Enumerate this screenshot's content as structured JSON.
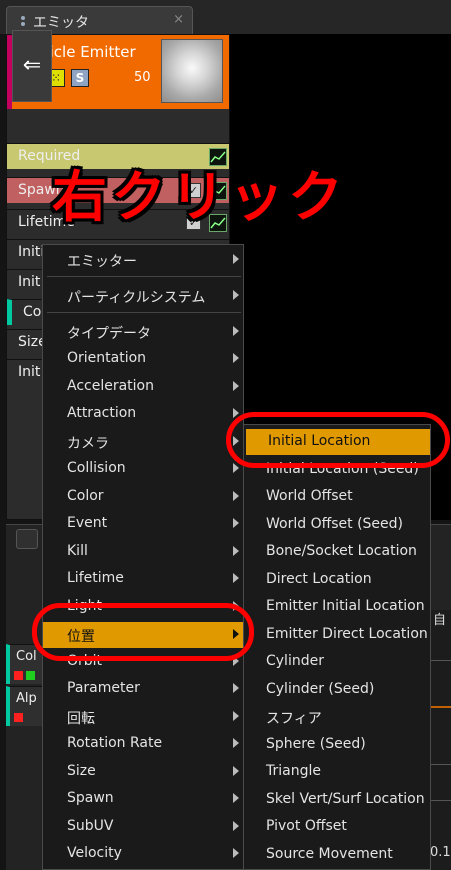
{
  "tab": {
    "title": "エミッタ",
    "close": "×"
  },
  "emitter": {
    "name": "Particle Emitter",
    "count": "50",
    "solo_label": "S",
    "colors": {
      "header": "#f06a00",
      "accent": "#c2005e"
    }
  },
  "modules": [
    {
      "label": "Required",
      "color": "#c8c870"
    },
    {
      "label": "Spawn",
      "color": "#c06060"
    },
    {
      "label": "Lifetime",
      "color": "#2c2c2c"
    },
    {
      "label": "Initial Size",
      "color": "#2c2c2c"
    },
    {
      "label": "Init",
      "color": "#2c2c2c"
    },
    {
      "label": "Col",
      "color": "#2c2c2c"
    },
    {
      "label": "Size",
      "color": "#2c2c2c"
    },
    {
      "label": "Init",
      "color": "#2c2c2c"
    }
  ],
  "annotation": {
    "text": "右クリック",
    "color": "#ff0000"
  },
  "lower": {
    "rows": [
      {
        "label": "Col"
      },
      {
        "label": "Alp"
      }
    ],
    "side_text": "自",
    "side_num": "0.1"
  },
  "context_menu": {
    "items": [
      {
        "label": "エミッター",
        "submenu": true
      },
      {
        "label": "パーティクルシステム",
        "submenu": true
      },
      {
        "label": "タイプデータ",
        "submenu": true
      },
      {
        "label": "Orientation",
        "submenu": true
      },
      {
        "label": "Acceleration",
        "submenu": true
      },
      {
        "label": "Attraction",
        "submenu": true
      },
      {
        "label": "カメラ",
        "submenu": true
      },
      {
        "label": "Collision",
        "submenu": true
      },
      {
        "label": "Color",
        "submenu": true
      },
      {
        "label": "Event",
        "submenu": true
      },
      {
        "label": "Kill",
        "submenu": true
      },
      {
        "label": "Lifetime",
        "submenu": true
      },
      {
        "label": "Light",
        "submenu": true
      },
      {
        "label": "位置",
        "submenu": true,
        "selected": true
      },
      {
        "label": "Orbit",
        "submenu": true
      },
      {
        "label": "Parameter",
        "submenu": true
      },
      {
        "label": "回転",
        "submenu": true
      },
      {
        "label": "Rotation Rate",
        "submenu": true
      },
      {
        "label": "Size",
        "submenu": true
      },
      {
        "label": "Spawn",
        "submenu": true
      },
      {
        "label": "SubUV",
        "submenu": true
      },
      {
        "label": "Velocity",
        "submenu": true
      }
    ],
    "highlight_color": "#e09a00"
  },
  "location_submenu": {
    "items": [
      {
        "label": "Initial Location",
        "selected": true
      },
      {
        "label": "Initial Location (Seed)"
      },
      {
        "label": "World Offset"
      },
      {
        "label": "World Offset (Seed)"
      },
      {
        "label": "Bone/Socket Location"
      },
      {
        "label": "Direct Location"
      },
      {
        "label": "Emitter Initial Location"
      },
      {
        "label": "Emitter Direct Location"
      },
      {
        "label": "Cylinder"
      },
      {
        "label": "Cylinder (Seed)"
      },
      {
        "label": "スフィア"
      },
      {
        "label": "Sphere (Seed)"
      },
      {
        "label": "Triangle"
      },
      {
        "label": "Skel Vert/Surf Location"
      },
      {
        "label": "Pivot Offset"
      },
      {
        "label": "Source Movement"
      }
    ]
  }
}
